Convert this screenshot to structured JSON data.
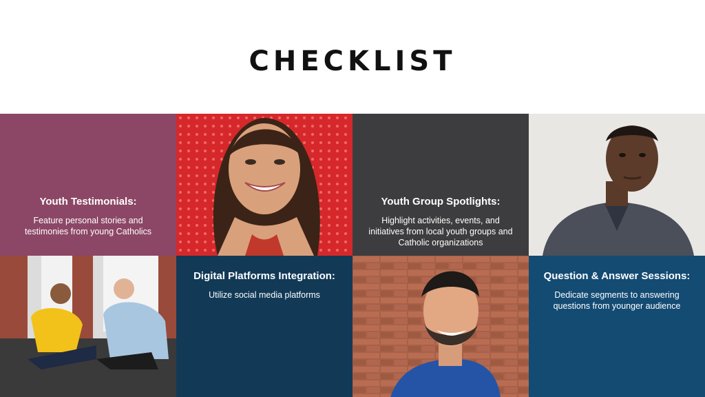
{
  "title": "CHECKLIST",
  "colors": {
    "purple": "#8c4766",
    "dark_gray": "#3d3d3f",
    "navy": "#123a57",
    "steel_blue": "#134b73"
  },
  "tiles": [
    {
      "heading": "Youth Testimonials:",
      "body": "Feature personal stories and testimonies from young Catholics"
    },
    {
      "heading": "Youth Group Spotlights:",
      "body": "Highlight activities, events, and initiatives from local youth groups and Catholic organizations"
    },
    {
      "heading": "Digital Platforms Integration:",
      "body": "Utilize social media platforms"
    },
    {
      "heading": "Question & Answer Sessions:",
      "body": "Dedicate segments to answering questions from younger audience"
    }
  ],
  "photos": [
    {
      "icon": "smiling-girl-photo"
    },
    {
      "icon": "man-portrait-photo"
    },
    {
      "icon": "two-young-women-talking-photo"
    },
    {
      "icon": "smiling-man-brick-wall-photo"
    }
  ]
}
